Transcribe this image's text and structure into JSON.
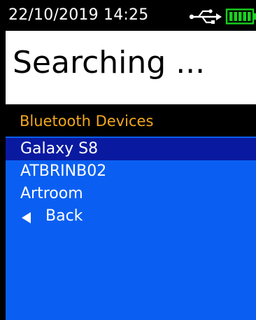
{
  "status_bar": {
    "datetime": "22/10/2019  14:25",
    "usb_icon": "usb-icon",
    "battery_icon": "battery-icon",
    "battery_level": 1.0,
    "colors": {
      "battery": "#19d11e",
      "text": "#ffffff"
    }
  },
  "title": "Searching ...",
  "section": {
    "title": "Bluetooth Devices",
    "color": "#f2a81d"
  },
  "devices": [
    {
      "label": "Galaxy S8",
      "selected": true
    },
    {
      "label": "ATBRINB02",
      "selected": false
    },
    {
      "label": "Artroom",
      "selected": false
    }
  ],
  "back": {
    "label": "Back",
    "icon": "back-arrow-icon"
  },
  "colors": {
    "list_background": "#0a5ff2",
    "selected_background": "#0a1aa0",
    "title_background": "#ffffff"
  }
}
